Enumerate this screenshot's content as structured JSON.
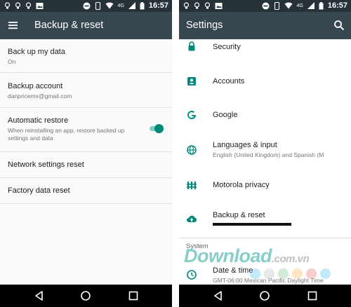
{
  "status_bar": {
    "time": "16:57",
    "network_label": "4G"
  },
  "left_screen": {
    "toolbar": {
      "title": "Backup & reset",
      "menu_icon": "hamburger-menu-icon"
    },
    "items": [
      {
        "title": "Back up my data",
        "summary": "On"
      },
      {
        "title": "Backup account",
        "summary": "danpricemx@gmail.com"
      },
      {
        "title": "Automatic restore",
        "summary": "When reinstalling an app, restore backed up settings and data",
        "toggle_on": true
      },
      {
        "title": "Network settings reset"
      },
      {
        "title": "Factory data reset"
      }
    ]
  },
  "right_screen": {
    "toolbar": {
      "title": "Settings",
      "search_icon": "search-icon"
    },
    "items": [
      {
        "title": "Security",
        "icon": "lock-icon"
      },
      {
        "title": "Accounts",
        "icon": "account-icon"
      },
      {
        "title": "Google",
        "icon": "google-icon"
      },
      {
        "title": "Languages & input",
        "summary": "English (United Kingdom) and Spanish (M",
        "icon": "globe-icon"
      },
      {
        "title": "Motorola privacy",
        "icon": "privacy-fence-icon"
      },
      {
        "title": "Backup & reset",
        "icon": "cloud-upload-icon"
      }
    ],
    "section_header": "System",
    "system_items": [
      {
        "title": "Date & time",
        "summary": "GMT-06:00 Mexican Pacific Daylight Time",
        "icon": "clock-icon"
      }
    ]
  },
  "watermark": {
    "text": "Download",
    "suffix": ".com.vn"
  },
  "colors": {
    "toolbar": "#37474f",
    "status_bar": "#263238",
    "accent": "#00897b",
    "nav_bar": "#000000"
  }
}
